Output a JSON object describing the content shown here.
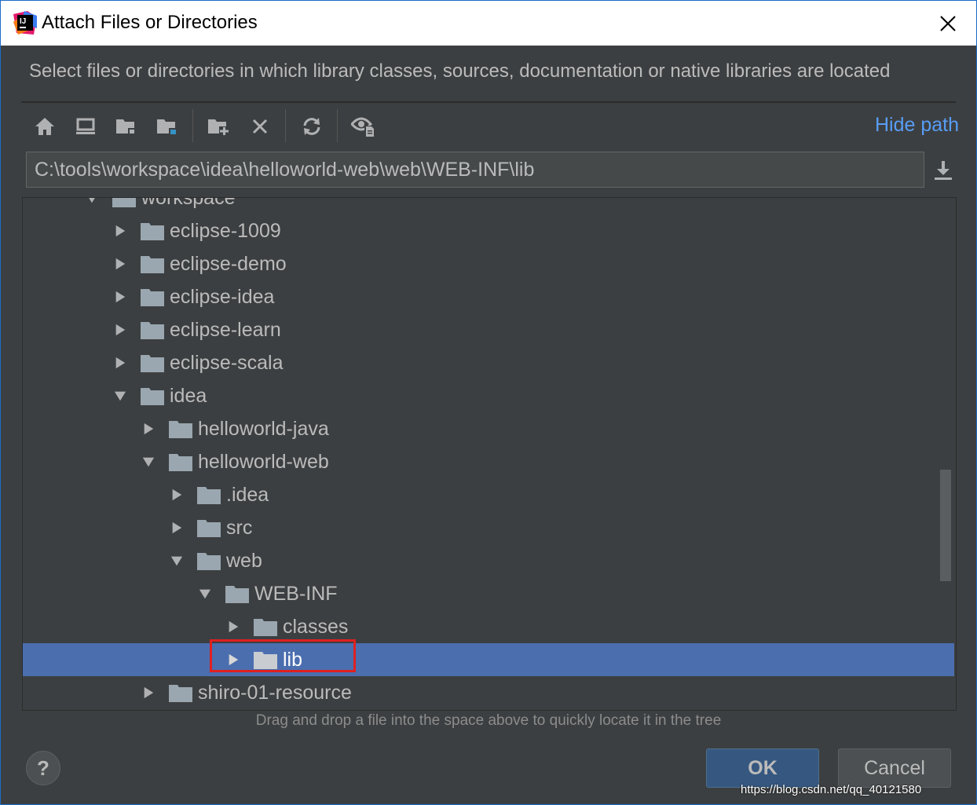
{
  "window": {
    "title": "Attach Files or Directories",
    "description": "Select files or directories in which library classes, sources, documentation or native libraries are located"
  },
  "toolbar": {
    "buttons": [
      "home-icon",
      "desktop-icon",
      "project-icon",
      "module-icon",
      "new-folder-icon",
      "delete-icon",
      "refresh-icon",
      "show-hidden-icon"
    ],
    "hide_path_label": "Hide path"
  },
  "path": {
    "value": "C:\\tools\\workspace\\idea\\helloworld-web\\web\\WEB-INF\\lib"
  },
  "tree": {
    "rows": [
      {
        "label": "workspace",
        "expanded": true,
        "depth": 0
      },
      {
        "label": "eclipse-1009",
        "expanded": false,
        "depth": 1
      },
      {
        "label": "eclipse-demo",
        "expanded": false,
        "depth": 1
      },
      {
        "label": "eclipse-idea",
        "expanded": false,
        "depth": 1
      },
      {
        "label": "eclipse-learn",
        "expanded": false,
        "depth": 1
      },
      {
        "label": "eclipse-scala",
        "expanded": false,
        "depth": 1
      },
      {
        "label": "idea",
        "expanded": true,
        "depth": 1
      },
      {
        "label": "helloworld-java",
        "expanded": false,
        "depth": 2
      },
      {
        "label": "helloworld-web",
        "expanded": true,
        "depth": 2
      },
      {
        "label": ".idea",
        "expanded": false,
        "depth": 3
      },
      {
        "label": "src",
        "expanded": false,
        "depth": 3
      },
      {
        "label": "web",
        "expanded": true,
        "depth": 3
      },
      {
        "label": "WEB-INF",
        "expanded": true,
        "depth": 4
      },
      {
        "label": "classes",
        "expanded": false,
        "depth": 5
      },
      {
        "label": "lib",
        "expanded": false,
        "depth": 5,
        "selected": true
      },
      {
        "label": "shiro-01-resource",
        "expanded": false,
        "depth": 2
      }
    ]
  },
  "hint": "Drag and drop a file into the space above to quickly locate it in the tree",
  "buttons": {
    "help": "?",
    "ok": "OK",
    "cancel": "Cancel"
  },
  "watermark": "https://blog.csdn.net/qq_40121580",
  "colors": {
    "background": "#3c3f41",
    "selection": "#4b6eaf",
    "link": "#589df6",
    "highlight_border": "#e02020"
  }
}
